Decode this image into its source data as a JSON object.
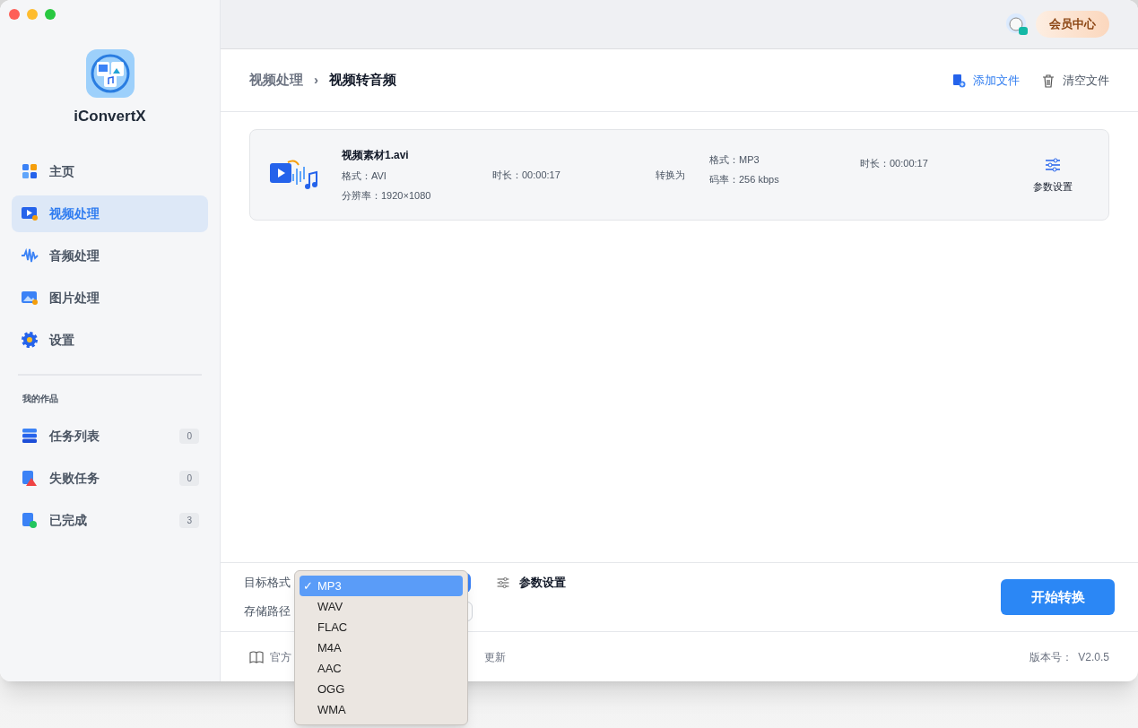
{
  "app": {
    "name": "iConvertX"
  },
  "sidebar": {
    "items": [
      {
        "label": "主页",
        "selected": false
      },
      {
        "label": "视频处理",
        "selected": true
      },
      {
        "label": "音频处理",
        "selected": false
      },
      {
        "label": "图片处理",
        "selected": false
      },
      {
        "label": "设置",
        "selected": false
      }
    ],
    "section_title": "我的作品",
    "works": [
      {
        "label": "任务列表",
        "count": "0"
      },
      {
        "label": "失败任务",
        "count": "0"
      },
      {
        "label": "已完成",
        "count": "3"
      }
    ]
  },
  "topbar": {
    "member_button": "会员中心"
  },
  "breadcrumb": {
    "items": [
      "视频处理",
      "视频转音频"
    ],
    "separator": "›"
  },
  "actions": [
    {
      "label": "添加文件",
      "kind": "add"
    },
    {
      "label": "清空文件",
      "kind": "clear"
    }
  ],
  "files": [
    {
      "name": "视频素材1.avi",
      "format": "格式：AVI",
      "duration": "时长：00:00:17",
      "resolution": "分辨率：1920×1080",
      "convert_label": "转换为",
      "target_format": "格式：MP3",
      "bitrate": "码率：256 kbps",
      "target_duration": "时长：00:00:17",
      "settings_label": "参数设置"
    }
  ],
  "bottom": {
    "format_label": "目标格式",
    "path_label": "存储路径",
    "settings_label": "参数设置",
    "start_button": "开始转换"
  },
  "format_menu": {
    "check": "✓",
    "options": [
      {
        "label": "MP3",
        "selected": true
      },
      {
        "label": "WAV",
        "selected": false
      },
      {
        "label": "FLAC",
        "selected": false
      },
      {
        "label": "M4A",
        "selected": false
      },
      {
        "label": "AAC",
        "selected": false
      },
      {
        "label": "OGG",
        "selected": false
      },
      {
        "label": "WMA",
        "selected": false
      }
    ]
  },
  "footer": {
    "left": "官方",
    "middle": "更新",
    "version": "版本号：  V2.0.5"
  }
}
